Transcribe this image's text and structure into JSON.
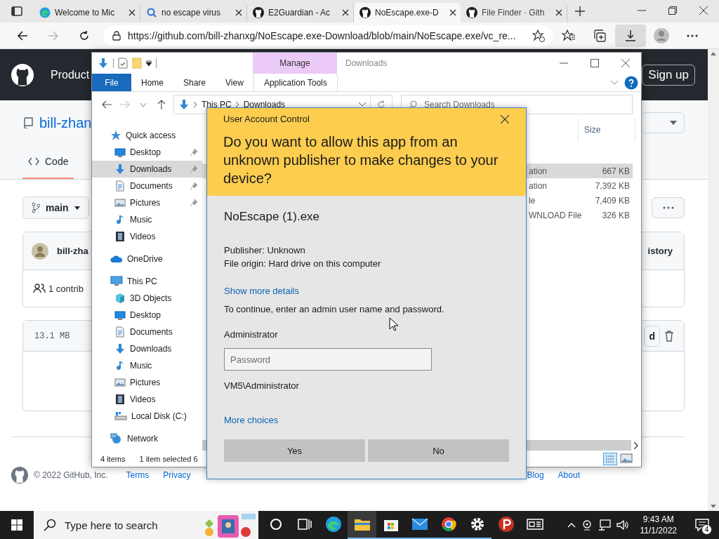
{
  "browser": {
    "tabs": [
      {
        "title": "Welcome to Mic",
        "kind": "edge",
        "selected": false
      },
      {
        "title": "no escape virus",
        "kind": "search",
        "selected": false
      },
      {
        "title": "E2Guardian - Ac",
        "kind": "github",
        "selected": false
      },
      {
        "title": "NoEscape.exe-D",
        "kind": "github",
        "selected": true
      },
      {
        "title": "File Finder · Gith",
        "kind": "github",
        "selected": false
      }
    ],
    "address": "https://github.com/bill-zhanxg/NoEscape.exe-Download/blob/main/NoEscape.exe/vc_re..."
  },
  "github": {
    "nav_item": "Product",
    "sign_up": "Sign up",
    "repo_owner": "bill-zhan",
    "tab": "Code",
    "branch": "main",
    "commit_author": "bill-zha",
    "history": "istory",
    "contributors": "1 contrib",
    "file_size": "13.1 MB",
    "file_button": "d",
    "footer": {
      "copyright": "© 2022 GitHub, Inc.",
      "links": [
        "Terms",
        "Privacy",
        "Blog",
        "About"
      ]
    }
  },
  "explorer": {
    "context_tab": "Manage",
    "title": "Downloads",
    "ribbon_tabs": [
      {
        "label": "File",
        "kind": "file"
      },
      {
        "label": "Home",
        "kind": "tab"
      },
      {
        "label": "Share",
        "kind": "tab"
      },
      {
        "label": "View",
        "kind": "tab"
      },
      {
        "label": "Application Tools",
        "kind": "context"
      }
    ],
    "path": [
      "This PC",
      "Downloads"
    ],
    "search_placeholder": "Search Downloads",
    "nav": [
      {
        "label": "Quick access",
        "kind": "star",
        "selected": false,
        "children": [
          {
            "label": "Desktop",
            "kind": "desktop",
            "pinned": true,
            "selected": false
          },
          {
            "label": "Downloads",
            "kind": "downloads",
            "pinned": true,
            "selected": true
          },
          {
            "label": "Documents",
            "kind": "documents",
            "pinned": true,
            "selected": false
          },
          {
            "label": "Pictures",
            "kind": "pictures",
            "pinned": true,
            "selected": false
          },
          {
            "label": "Music",
            "kind": "music",
            "pinned": false,
            "selected": false
          },
          {
            "label": "Videos",
            "kind": "videos",
            "pinned": false,
            "selected": false
          }
        ]
      },
      {
        "label": "OneDrive",
        "kind": "cloud",
        "selected": false
      },
      {
        "label": "This PC",
        "kind": "pc",
        "selected": false,
        "children": [
          {
            "label": "3D Objects",
            "kind": "cube",
            "selected": false
          },
          {
            "label": "Desktop",
            "kind": "desktop",
            "selected": false
          },
          {
            "label": "Documents",
            "kind": "documents",
            "selected": false
          },
          {
            "label": "Downloads",
            "kind": "downloads",
            "selected": false
          },
          {
            "label": "Music",
            "kind": "music",
            "selected": false
          },
          {
            "label": "Pictures",
            "kind": "pictures",
            "selected": false
          },
          {
            "label": "Videos",
            "kind": "videos",
            "selected": false
          },
          {
            "label": "Local Disk (C:)",
            "kind": "disk",
            "selected": false
          }
        ]
      },
      {
        "label": "Network",
        "kind": "network",
        "selected": false
      }
    ],
    "column": "Size",
    "files": [
      {
        "type": "ation",
        "size": "667 KB",
        "selected": true
      },
      {
        "type": "ation",
        "size": "7,392 KB",
        "selected": false
      },
      {
        "type": "le",
        "size": "7,409 KB",
        "selected": false
      },
      {
        "type": "WNLOAD File",
        "size": "326 KB",
        "selected": false
      }
    ],
    "status": {
      "count": "4 items",
      "selection": "1 item selected 6"
    }
  },
  "uac": {
    "title": "User Account Control",
    "question": "Do you want to allow this app from an unknown publisher to make changes to your device?",
    "app": "NoEscape (1).exe",
    "publisher": "Publisher: Unknown",
    "origin": "File origin: Hard drive on this computer",
    "details_link": "Show more details",
    "instruction": "To continue, enter an admin user name and password.",
    "user": "Administrator",
    "password_placeholder": "Password",
    "account": "VM5\\Administrator",
    "choices_link": "More choices",
    "buttons": [
      "Yes",
      "No"
    ]
  },
  "taskbar": {
    "search_placeholder": "Type here to search",
    "apps": [
      {
        "kind": "cortana",
        "running": false,
        "active": false
      },
      {
        "kind": "taskview",
        "running": false,
        "active": false
      },
      {
        "kind": "edge",
        "running": false,
        "active": false
      },
      {
        "kind": "explorer",
        "running": true,
        "active": true
      },
      {
        "kind": "store",
        "running": true,
        "active": false
      },
      {
        "kind": "mail",
        "running": true,
        "active": false
      },
      {
        "kind": "chrome",
        "running": true,
        "active": false
      },
      {
        "kind": "settings",
        "running": true,
        "active": false
      },
      {
        "kind": "psiphon",
        "running": false,
        "active": false
      },
      {
        "kind": "news",
        "running": false,
        "active": false
      }
    ],
    "time": "9:43 AM",
    "date": "11/1/2022",
    "notifications": "4"
  }
}
